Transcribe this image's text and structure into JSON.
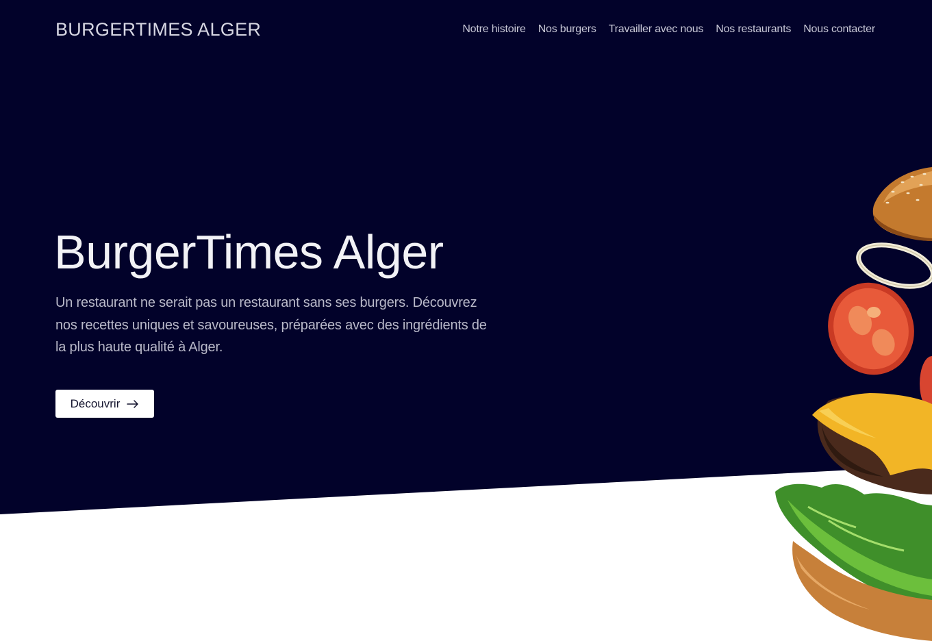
{
  "colors": {
    "hero_background": "#02022a",
    "page_background": "#ffffff",
    "button_background": "#ffffff",
    "button_text": "#14142e"
  },
  "navbar": {
    "brand": "BURGERTIMES ALGER",
    "links": [
      {
        "label": "Notre histoire"
      },
      {
        "label": "Nos burgers"
      },
      {
        "label": "Travailler avec nous"
      },
      {
        "label": "Nos restaurants"
      },
      {
        "label": "Nous contacter"
      }
    ]
  },
  "hero": {
    "title": "BurgerTimes Alger",
    "description": "Un restaurant ne serait pas un restaurant sans ses burgers. Découvrez nos recettes uniques et savoureuses, préparées avec des ingrédients de la plus haute qualité à Alger.",
    "cta_label": "Découvrir",
    "cta_icon": "arrow-right-icon",
    "image": "exploded-burger-illustration"
  }
}
